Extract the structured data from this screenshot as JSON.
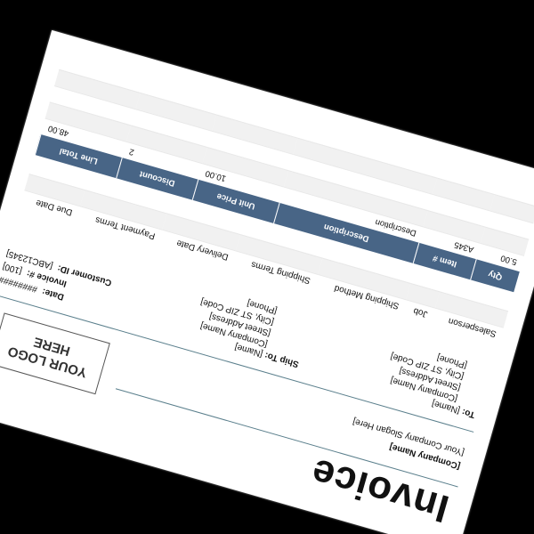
{
  "invoice": {
    "title": "Invoice",
    "company": {
      "name": "[Company Name]",
      "slogan": "[Your Company Slogan Here]"
    },
    "logo": [
      "YOUR LOGO",
      "HERE"
    ],
    "meta": {
      "date_label": "Date:",
      "date_value": "########",
      "invoice_label": "Invoice #:",
      "invoice_value": "[100]",
      "customer_label": "Customer ID:",
      "customer_value": "[ABC12345]"
    },
    "to": {
      "label": "To:",
      "lines": [
        "[Name]",
        "[Company Name]",
        "[Street Address]",
        "[City, ST ZIP Code]",
        "[Phone]"
      ]
    },
    "ship_to": {
      "label": "Ship To:",
      "lines": [
        "[Name]",
        "[Company Name]",
        "[Street Address]",
        "[City, ST ZIP Code]",
        "[Phone]"
      ]
    },
    "shipping_table": {
      "headers": [
        "Salesperson",
        "Job",
        "Shipping Method",
        "Shipping Terms",
        "Delivery Date",
        "Payment Terms",
        "Due Date"
      ]
    },
    "items_table": {
      "headers": [
        "Qty",
        "Item #",
        "Description",
        "Unit Price",
        "Discount",
        "Line Total"
      ],
      "rows": [
        [
          "5.00",
          "A345",
          "Description",
          "10.00",
          "2",
          "48.00"
        ]
      ]
    }
  }
}
